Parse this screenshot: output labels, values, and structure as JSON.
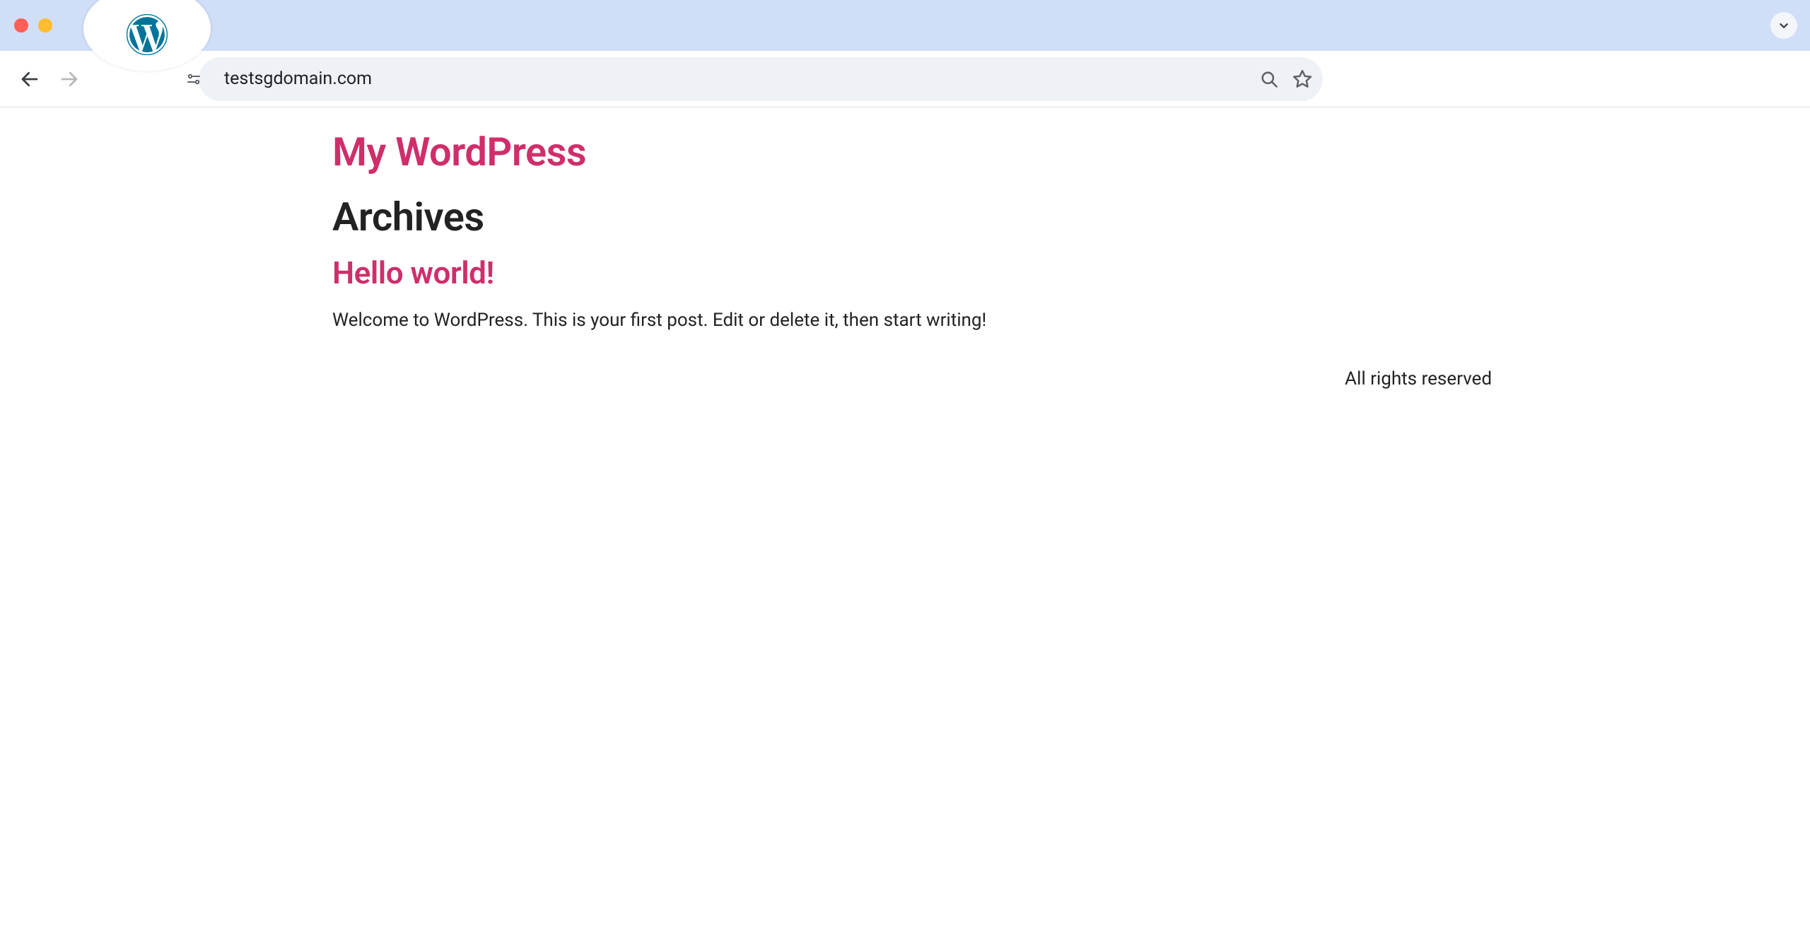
{
  "browser": {
    "url": "testsgdomain.com"
  },
  "site": {
    "title": "My WordPress"
  },
  "page": {
    "heading": "Archives",
    "post_title": "Hello world!",
    "post_excerpt": "Welcome to WordPress. This is your first post. Edit or delete it, then start writing!",
    "footer": "All rights reserved"
  }
}
